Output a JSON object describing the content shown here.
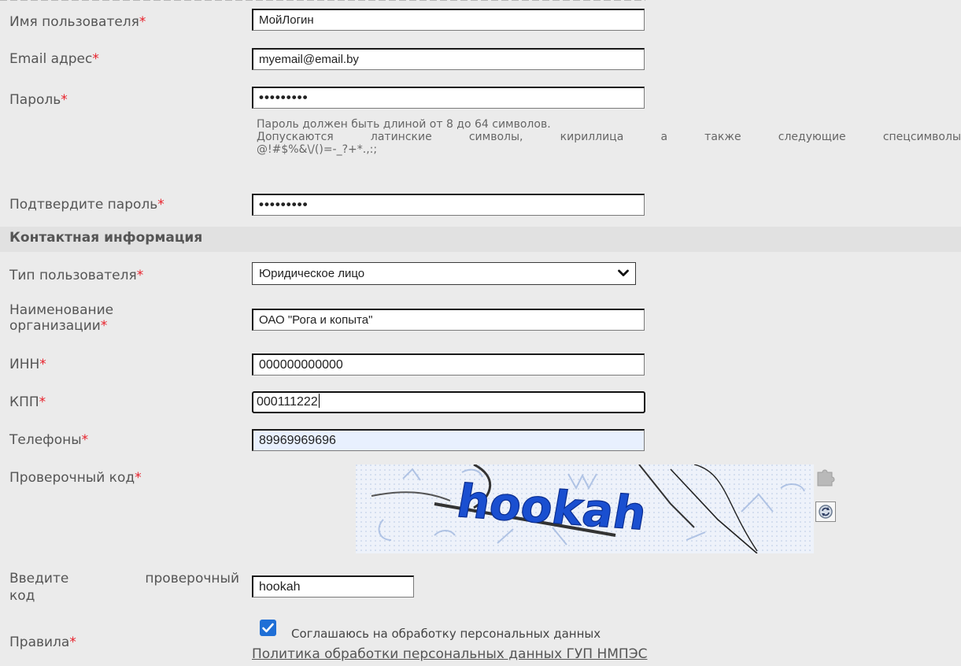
{
  "form": {
    "required_mark": "*",
    "username": {
      "label": "Имя пользователя",
      "value": "МойЛогин"
    },
    "email": {
      "label": "Email адрес",
      "value": "myemail@email.by"
    },
    "password": {
      "label": "Пароль",
      "value": "•••••••••"
    },
    "password_hint": {
      "line1": "Пароль должен быть длиной от 8 до 64 символов.",
      "line2": "Допускаются латинские символы, кириллица а также следующие спецсимволы",
      "line3": "@!#$%&\\/()=-_?+*.,:;"
    },
    "confirm_password": {
      "label": "Подтвердите пароль",
      "value": "•••••••••"
    }
  },
  "contact": {
    "section_title": "Контактная информация",
    "user_type": {
      "label": "Тип пользователя",
      "selected": "Юридическое лицо"
    },
    "org_name": {
      "label_line1": "Наименование",
      "label_line2": "организации",
      "value": "ОАО \"Рога и копыта\""
    },
    "inn": {
      "label": "ИНН",
      "value": "000000000000"
    },
    "kpp": {
      "label": "КПП",
      "value": "000111222"
    },
    "phones": {
      "label": "Телефоны",
      "value": "89969969696"
    },
    "captcha": {
      "label": "Проверочный код",
      "word": "hookah"
    },
    "captcha_input": {
      "label_line1a": "Введите",
      "label_line1b": "проверочный",
      "label_line2": "код",
      "value": "hookah"
    },
    "rules": {
      "label": "Правила",
      "consent_text": "Соглашаюсь на обработку персональных данных",
      "checked": true,
      "policy_link": "Политика обработки персональных данных ГУП НМПЭС"
    }
  },
  "colors": {
    "required": "#e8202a",
    "checkbox": "#1f6fd6",
    "autofill": "#e8f0fe",
    "captcha_text": "#1a4fd0"
  },
  "icons": {
    "select_arrow": "chevron-down-icon",
    "captcha_audio": "puzzle-icon",
    "captcha_refresh": "refresh-icon",
    "checkbox_mark": "checkmark-icon"
  }
}
